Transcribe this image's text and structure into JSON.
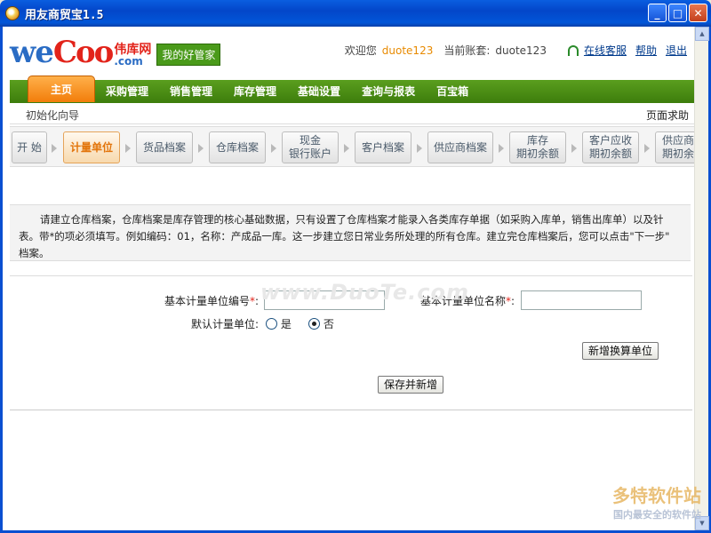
{
  "window": {
    "title": "用友商贸宝1.5",
    "min_label": "_",
    "max_label": "□",
    "close_label": "✕"
  },
  "header": {
    "logo_we": "we",
    "logo_coo": "Coo",
    "logo_cn": "伟库网",
    "logo_com": ".com",
    "tagline": "我的好管家",
    "welcome_label": "欢迎您",
    "user_name": "duote123",
    "account_label": "当前账套:",
    "account_name": "duote123",
    "support_link": "在线客服",
    "help_link": "帮助",
    "logout_link": "退出"
  },
  "nav": {
    "items": [
      "主页",
      "采购管理",
      "销售管理",
      "库存管理",
      "基础设置",
      "查询与报表",
      "百宝箱"
    ]
  },
  "subbar": {
    "wizard": "初始化向导",
    "help": "页面求助"
  },
  "steps": [
    {
      "l1": "开 始",
      "l2": ""
    },
    {
      "l1": "计量单位",
      "l2": ""
    },
    {
      "l1": "货品档案",
      "l2": ""
    },
    {
      "l1": "仓库档案",
      "l2": ""
    },
    {
      "l1": "现金",
      "l2": "银行账户"
    },
    {
      "l1": "客户档案",
      "l2": ""
    },
    {
      "l1": "供应商档案",
      "l2": ""
    },
    {
      "l1": "库存",
      "l2": "期初余额"
    },
    {
      "l1": "客户应收",
      "l2": "期初余额"
    },
    {
      "l1": "供应商应",
      "l2": "期初余额"
    }
  ],
  "info": {
    "line1": "请建立仓库档案，仓库档案是库存管理的核心基础数据，只有设置了仓库档案才能录入各类库存单据（如采购入库单，销售出库单）以及针",
    "line2": "表。带*的项必须填写。例如编码：01，名称：产成品一库。这一步建立您日常业务所处理的所有仓库。建立完仓库档案后，您可以点击\"下一步\"",
    "line3": "档案。"
  },
  "form": {
    "code_label": "基本计量单位编号",
    "name_label": "基本计量单位名称",
    "required_mark": "*",
    "colon": ":",
    "default_label": "默认计量单位:",
    "opt_yes": "是",
    "opt_no": "否",
    "add_conv_button": "新增换算单位",
    "save_new_button": "保存并新增",
    "code_value": "",
    "name_value": ""
  },
  "watermark": "www.DuoTe.com",
  "corner": {
    "big": "多特软件站",
    "small": "国内最安全的软件站"
  }
}
